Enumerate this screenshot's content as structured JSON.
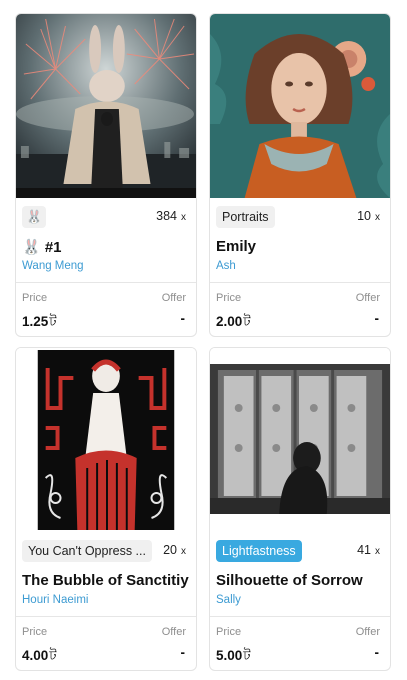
{
  "cards": [
    {
      "tag": "🐰",
      "count": "384",
      "count_suffix": "x",
      "title": "🐰 #1",
      "author": "Wang Meng",
      "price_label": "Price",
      "price": "1.25",
      "currency": "ট",
      "offer_label": "Offer",
      "offer": "-"
    },
    {
      "tag": "Portraits",
      "count": "10",
      "count_suffix": "x",
      "title": "Emily",
      "author": "Ash",
      "price_label": "Price",
      "price": "2.00",
      "currency": "ট",
      "offer_label": "Offer",
      "offer": "-"
    },
    {
      "tag": "You Can't Oppress ...",
      "count": "20",
      "count_suffix": "x",
      "title": "The Bubble of Sanctitiy",
      "author": "Houri Naeimi",
      "price_label": "Price",
      "price": "4.00",
      "currency": "ট",
      "offer_label": "Offer",
      "offer": "-"
    },
    {
      "tag": "Lightfastness",
      "count": "41",
      "count_suffix": "x",
      "title": "Silhouette of Sorrow",
      "author": "Sally",
      "price_label": "Price",
      "price": "5.00",
      "currency": "ট",
      "offer_label": "Offer",
      "offer": "-"
    }
  ],
  "colors": {
    "author_link": "#3d9bd2",
    "tag_highlight": "#39a9e0",
    "tag_default": "#f0f0f0"
  }
}
